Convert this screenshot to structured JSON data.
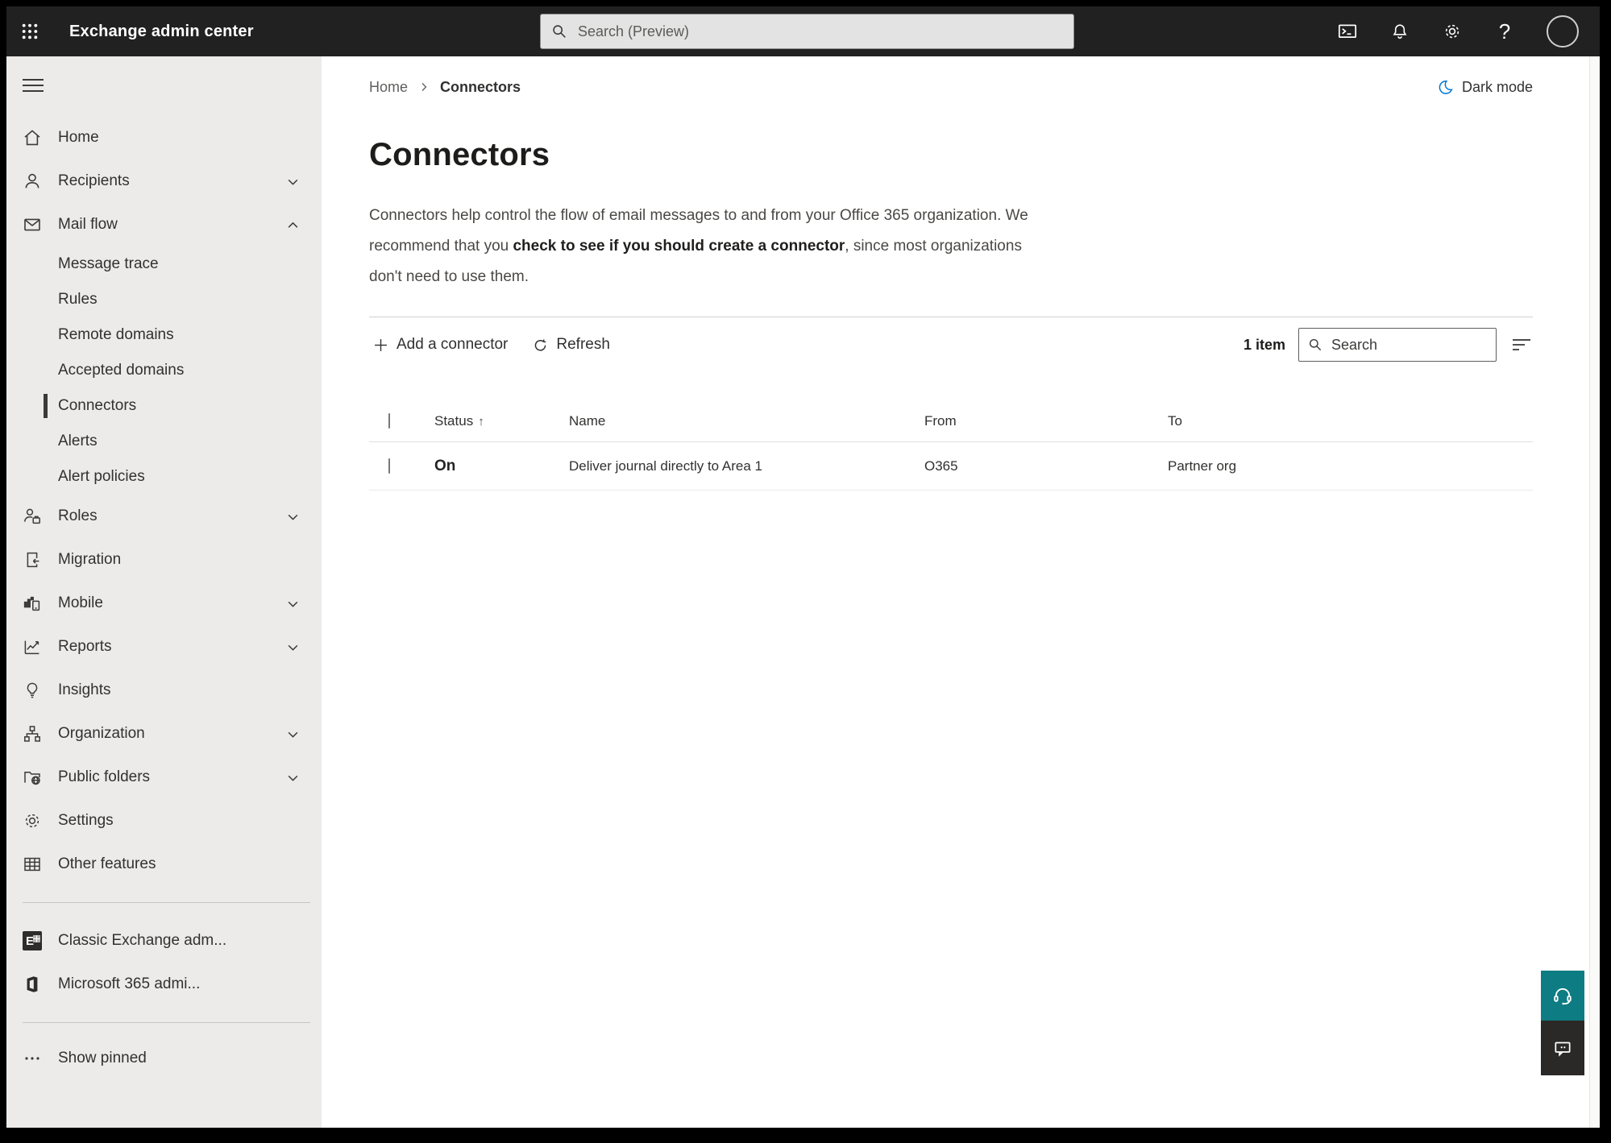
{
  "header": {
    "app_title": "Exchange admin center",
    "search_placeholder": "Search (Preview)"
  },
  "sidebar": {
    "items": [
      {
        "label": "Home"
      },
      {
        "label": "Recipients"
      },
      {
        "label": "Mail flow"
      },
      {
        "label": "Message trace"
      },
      {
        "label": "Rules"
      },
      {
        "label": "Remote domains"
      },
      {
        "label": "Accepted domains"
      },
      {
        "label": "Connectors"
      },
      {
        "label": "Alerts"
      },
      {
        "label": "Alert policies"
      },
      {
        "label": "Roles"
      },
      {
        "label": "Migration"
      },
      {
        "label": "Mobile"
      },
      {
        "label": "Reports"
      },
      {
        "label": "Insights"
      },
      {
        "label": "Organization"
      },
      {
        "label": "Public folders"
      },
      {
        "label": "Settings"
      },
      {
        "label": "Other features"
      },
      {
        "label": "Classic Exchange adm...",
        "logo_letter": "E"
      },
      {
        "label": "Microsoft 365 admi..."
      },
      {
        "label": "Show pinned"
      }
    ]
  },
  "breadcrumb": {
    "home": "Home",
    "current": "Connectors"
  },
  "theme_toggle": {
    "label": "Dark mode"
  },
  "page": {
    "title": "Connectors",
    "description_before": "Connectors help control the flow of email messages to and from your Office 365 organization. We recommend that you ",
    "description_link": "check to see if you should create a connector",
    "description_after": ", since most organizations don't need to use them."
  },
  "toolbar": {
    "add_connector_label": "Add a connector",
    "refresh_label": "Refresh",
    "item_count": "1 item",
    "search_placeholder": "Search"
  },
  "table": {
    "headers": {
      "status": "Status",
      "name": "Name",
      "from": "From",
      "to": "To"
    },
    "rows": [
      {
        "status": "On",
        "name": "Deliver journal directly to Area 1",
        "from": "O365",
        "to": "Partner org"
      }
    ]
  },
  "icons": {
    "help_glyph": "?",
    "sort_asc_glyph": "↑"
  },
  "colors": {
    "header_bg": "#212121",
    "sidebar_bg": "#edebe9",
    "accent_teal": "#0e7c83",
    "link_blue": "#0078d4",
    "feedback_dark": "#2b2927"
  }
}
